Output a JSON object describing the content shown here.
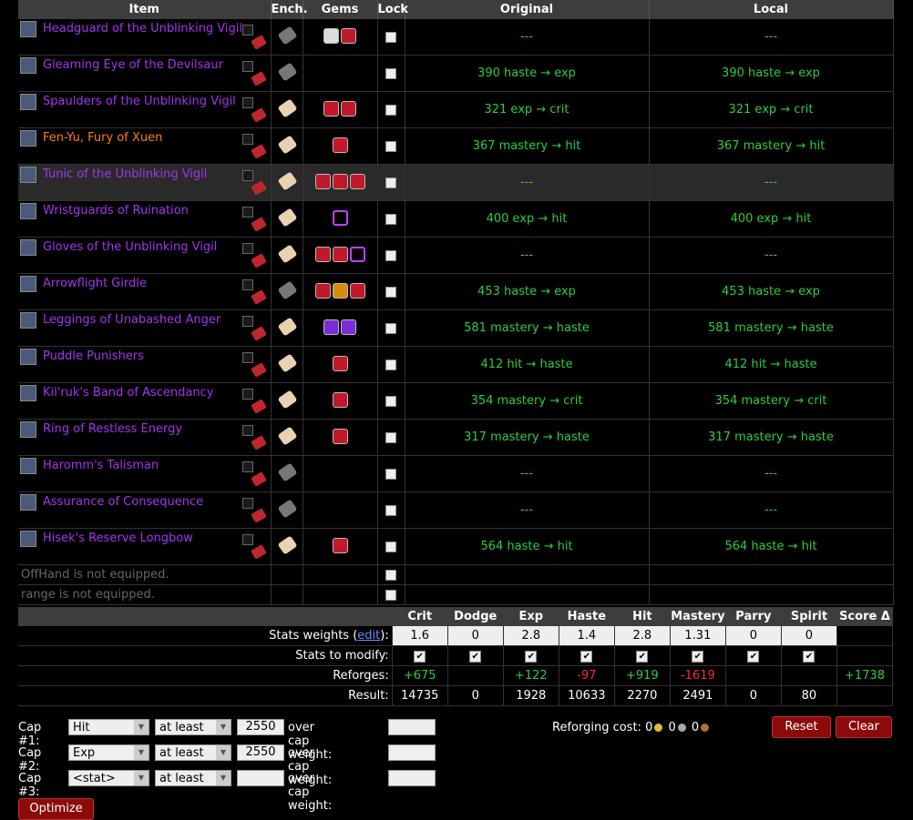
{
  "headers": {
    "item": "Item",
    "ench": "Ench.",
    "gems": "Gems",
    "lock": "Lock",
    "original": "Original",
    "local": "Local"
  },
  "items": [
    {
      "name": "Headguard of the Unblinking Vigil",
      "quality": "epic",
      "enchanted": false,
      "gems": [
        "meta",
        "red"
      ],
      "original": "---",
      "local": "---"
    },
    {
      "name": "Gleaming Eye of the Devilsaur",
      "quality": "epic",
      "enchanted": false,
      "gems": [],
      "original": "390 haste → exp",
      "local": "390 haste → exp"
    },
    {
      "name": "Spaulders of the Unblinking Vigil",
      "quality": "epic",
      "enchanted": true,
      "gems": [
        "red",
        "red"
      ],
      "original": "321 exp → crit",
      "local": "321 exp → crit"
    },
    {
      "name": "Fen-Yu, Fury of Xuen",
      "quality": "legendary",
      "enchanted": true,
      "gems": [
        "red"
      ],
      "original": "367 mastery → hit",
      "local": "367 mastery → hit"
    },
    {
      "name": "Tunic of the Unblinking Vigil",
      "quality": "epic",
      "enchanted": true,
      "gems": [
        "red",
        "red",
        "red"
      ],
      "original": "---",
      "local": "---"
    },
    {
      "name": "Wristguards of Ruination",
      "quality": "epic",
      "enchanted": true,
      "gems": [
        "prism"
      ],
      "original": "400 exp → hit",
      "local": "400 exp → hit"
    },
    {
      "name": "Gloves of the Unblinking Vigil",
      "quality": "epic",
      "enchanted": true,
      "gems": [
        "red",
        "red",
        "prism"
      ],
      "original": "---",
      "local": "---"
    },
    {
      "name": "Arrowflight Girdle",
      "quality": "epic",
      "enchanted": false,
      "gems": [
        "red",
        "orange",
        "red"
      ],
      "original": "453 haste → exp",
      "local": "453 haste → exp"
    },
    {
      "name": "Leggings of Unabashed Anger",
      "quality": "epic",
      "enchanted": true,
      "gems": [
        "purple",
        "purple"
      ],
      "original": "581 mastery → haste",
      "local": "581 mastery → haste"
    },
    {
      "name": "Puddle Punishers",
      "quality": "epic",
      "enchanted": true,
      "gems": [
        "red"
      ],
      "original": "412 hit → haste",
      "local": "412 hit → haste"
    },
    {
      "name": "Kil'ruk's Band of Ascendancy",
      "quality": "epic",
      "enchanted": true,
      "gems": [
        "red"
      ],
      "original": "354 mastery → crit",
      "local": "354 mastery → crit"
    },
    {
      "name": "Ring of Restless Energy",
      "quality": "epic",
      "enchanted": true,
      "gems": [
        "red"
      ],
      "original": "317 mastery → haste",
      "local": "317 mastery → haste"
    },
    {
      "name": "Haromm's Talisman",
      "quality": "epic",
      "enchanted": false,
      "gems": [],
      "original": "---",
      "local": "---"
    },
    {
      "name": "Assurance of Consequence",
      "quality": "epic",
      "enchanted": false,
      "gems": [],
      "original": "---",
      "local": "---"
    },
    {
      "name": "Hisek's Reserve Longbow",
      "quality": "epic",
      "enchanted": true,
      "gems": [
        "red"
      ],
      "original": "564 haste → hit",
      "local": "564 haste → hit"
    }
  ],
  "not_equipped": [
    "OffHand is not equipped.",
    "range is not equipped."
  ],
  "stats": {
    "headers": [
      "Crit",
      "Dodge",
      "Exp",
      "Haste",
      "Hit",
      "Mastery",
      "Parry",
      "Spirit",
      "Score Δ"
    ],
    "weights_label": "Stats weights (",
    "edit_label": "edit",
    "weights_label_end": "):",
    "weights": [
      "1.6",
      "0",
      "2.8",
      "1.4",
      "2.8",
      "1.31",
      "0",
      "0"
    ],
    "modify_label": "Stats to modify:",
    "reforges_label": "Reforges:",
    "reforges": [
      "+675",
      "",
      "+122",
      "-97",
      "+919",
      "-1619",
      "",
      "",
      "+1738"
    ],
    "result_label": "Result:",
    "result": [
      "14735",
      "0",
      "1928",
      "10633",
      "2270",
      "2491",
      "0",
      "80",
      ""
    ]
  },
  "caps": [
    {
      "label": "Cap #1:",
      "stat": "Hit",
      "op": "at least",
      "value": "2550",
      "ocw_label": "over cap weight:",
      "ocw": ""
    },
    {
      "label": "Cap #2:",
      "stat": "Exp",
      "op": "at least",
      "value": "2550",
      "ocw_label": "over cap weight:",
      "ocw": ""
    },
    {
      "label": "Cap #3:",
      "stat": "<stat>",
      "op": "at least",
      "value": "",
      "ocw_label": "over cap weight:",
      "ocw": ""
    }
  ],
  "reforging_cost": {
    "label": "Reforging cost:",
    "gold": "0",
    "silver": "0",
    "copper": "0"
  },
  "buttons": {
    "reset": "Reset",
    "clear": "Clear",
    "optimize": "Optimize"
  },
  "colors": {
    "epic": "#a335ee",
    "legendary": "#ff8000",
    "positive": "#2ecc40",
    "negative": "#ff2a2a",
    "button": "#8b0a0a"
  }
}
